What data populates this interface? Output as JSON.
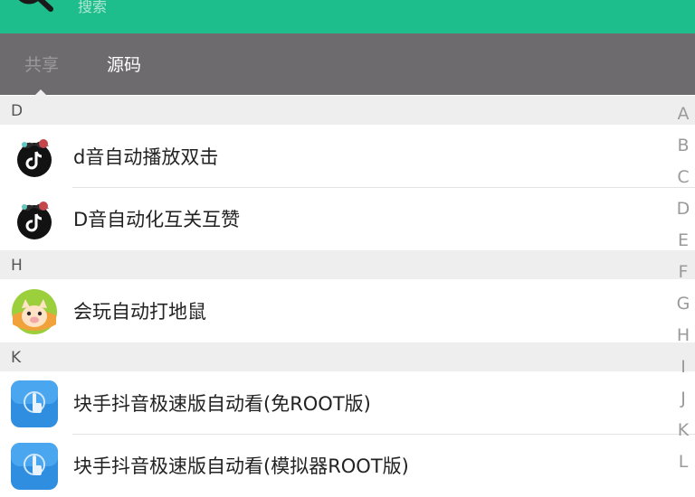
{
  "search": {
    "placeholder": "搜索"
  },
  "tabs": [
    {
      "label": "共享"
    },
    {
      "label": "源码"
    }
  ],
  "sections": [
    {
      "letter": "D"
    },
    {
      "letter": "H"
    },
    {
      "letter": "K"
    }
  ],
  "items": [
    {
      "label": "d音自动播放双击",
      "icon": "tiktok-ninja-icon"
    },
    {
      "label": "D音自动化互关互赞",
      "icon": "tiktok-ninja-icon"
    },
    {
      "label": "会玩自动打地鼠",
      "icon": "cartoon-pig-icon"
    },
    {
      "label": "块手抖音极速版自动看(免ROOT版)",
      "icon": "touch-gesture-icon"
    },
    {
      "label": "块手抖音极速版自动看(模拟器ROOT版)",
      "icon": "touch-gesture-icon"
    }
  ],
  "index_letters": [
    "A",
    "B",
    "C",
    "D",
    "E",
    "F",
    "G",
    "H",
    "I",
    "J",
    "K",
    "L"
  ],
  "colors": {
    "accent": "#1dbd8c",
    "tabbar": "#6e6b6e",
    "section_bg": "#efeeef"
  }
}
